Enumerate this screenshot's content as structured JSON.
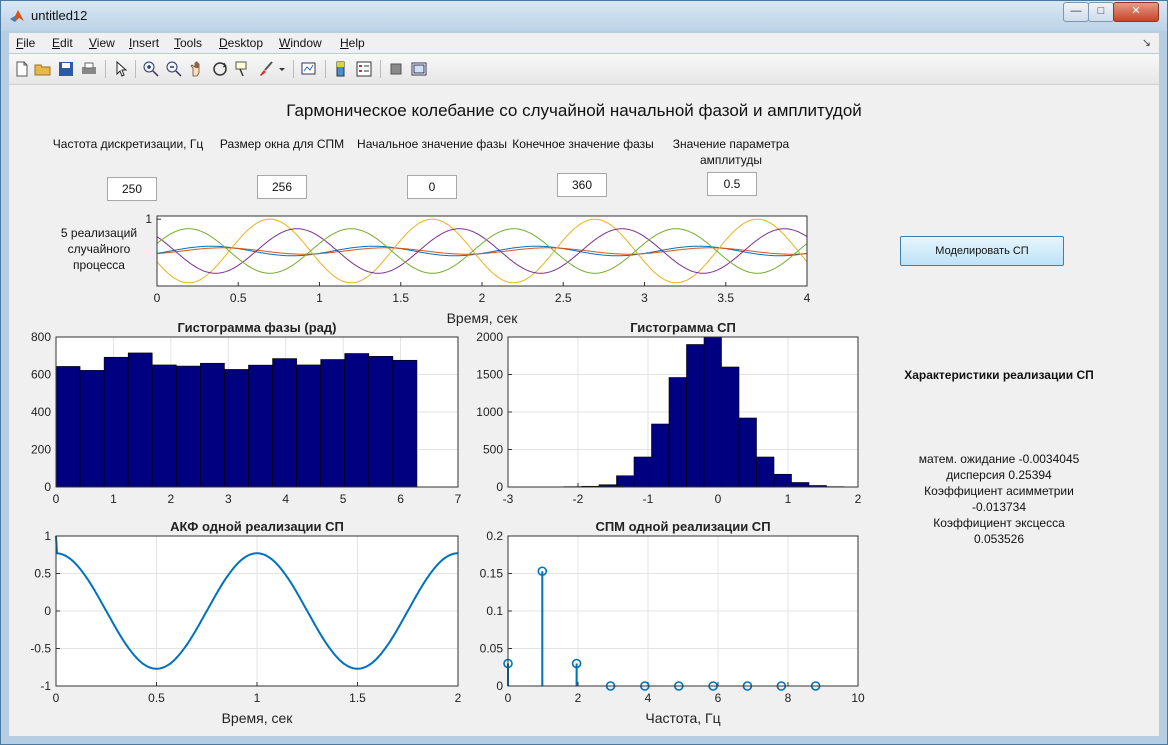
{
  "window": {
    "title": "untitled12",
    "controls": {
      "minimize": "—",
      "maximize": "□",
      "close": "✕"
    }
  },
  "menu": {
    "items": [
      {
        "label": "File",
        "key": "F"
      },
      {
        "label": "Edit",
        "key": "E"
      },
      {
        "label": "View",
        "key": "V"
      },
      {
        "label": "Insert",
        "key": "I"
      },
      {
        "label": "Tools",
        "key": "T"
      },
      {
        "label": "Desktop",
        "key": "D"
      },
      {
        "label": "Window",
        "key": "W"
      },
      {
        "label": "Help",
        "key": "H"
      }
    ],
    "overflow_arrow": "↘"
  },
  "toolbar": {
    "icons": [
      "new-figure-icon",
      "open-file-icon",
      "save-icon",
      "print-icon",
      "pointer-icon",
      "zoom-in-icon",
      "zoom-out-icon",
      "pan-icon",
      "rotate-3d-icon",
      "data-cursor-icon",
      "brush-icon",
      "link-plot-icon",
      "insert-colorbar-icon",
      "insert-legend-icon",
      "hide-plot-tools-icon",
      "show-plot-tools-icon"
    ]
  },
  "figure": {
    "title": "Гармоническое колебание со случайной начальной фазой и амплитудой",
    "params": [
      {
        "label": "Частота дискретизации, Гц",
        "value": "250"
      },
      {
        "label": "Размер окна для СПМ",
        "value": "256"
      },
      {
        "label": "Начальное значение фазы",
        "value": "0"
      },
      {
        "label": "Конечное значение фазы",
        "value": "360"
      },
      {
        "label": "Значение параметра амплитуды",
        "value": "0.5"
      }
    ],
    "process_label": "5 реализаций случайного процесса",
    "simulate_button": "Моделировать СП",
    "stats": {
      "title": "Характеристики реализации СП",
      "lines": [
        "матем. ожидание  -0.0034045",
        "дисперсия  0.25394",
        "Коэффициент асимметрии",
        "-0.013734",
        "Коэффициент эксцесса",
        "0.053526"
      ]
    }
  },
  "colors": {
    "bar_fill": "#000080",
    "line_blue": "#0072BD",
    "series": [
      "#0072BD",
      "#D95319",
      "#EDB120",
      "#7E2F8E",
      "#77AC30"
    ],
    "stem": "#0072BD"
  },
  "chart_data": [
    {
      "type": "line",
      "title": "",
      "xlabel": "Время, сек",
      "ylabel": "",
      "xlim": [
        0,
        4
      ],
      "ylim": [
        -1.1,
        1.1
      ],
      "xticks": [
        "0",
        "0.5",
        "1",
        "1.5",
        "2",
        "2.5",
        "3",
        "3.5",
        "4"
      ],
      "yticks": [
        "1"
      ],
      "grid": false,
      "frequency_hz": 1,
      "series": [
        {
          "amplitude": 0.15,
          "phase_deg": 330
        },
        {
          "amplitude": 0.1,
          "phase_deg": 305
        },
        {
          "amplitude": 1.0,
          "phase_deg": 200
        },
        {
          "amplitude": 0.7,
          "phase_deg": 140
        },
        {
          "amplitude": 0.7,
          "phase_deg": 20
        }
      ]
    },
    {
      "type": "bar",
      "title": "Гистограмма фазы (рад)",
      "xlabel": "",
      "ylabel": "",
      "xlim": [
        0,
        7
      ],
      "ylim": [
        0,
        800
      ],
      "xticks": [
        "0",
        "1",
        "2",
        "3",
        "4",
        "5",
        "6",
        "7"
      ],
      "yticks": [
        "0",
        "200",
        "400",
        "600",
        "800"
      ],
      "grid": true,
      "bin_start": 0,
      "bin_width": 0.419,
      "values": [
        643,
        622,
        692,
        715,
        651,
        645,
        660,
        627,
        650,
        685,
        651,
        680,
        712,
        697,
        676
      ]
    },
    {
      "type": "bar",
      "title": "Гистограмма СП",
      "xlabel": "",
      "ylabel": "",
      "xlim": [
        -3,
        2
      ],
      "ylim": [
        0,
        2000
      ],
      "xticks": [
        "-3",
        "-2",
        "-1",
        "0",
        "1",
        "2"
      ],
      "yticks": [
        "0",
        "500",
        "1000",
        "1500",
        "2000"
      ],
      "grid": true,
      "bin_start": -2.2,
      "bin_width": 0.25,
      "values": [
        5,
        10,
        30,
        150,
        400,
        840,
        1460,
        1900,
        2000,
        1600,
        920,
        400,
        170,
        60,
        20,
        5
      ]
    },
    {
      "type": "line",
      "title": "АКФ одной реализации СП",
      "xlabel": "Время, сек",
      "ylabel": "",
      "xlim": [
        0,
        2
      ],
      "ylim": [
        -1,
        1
      ],
      "xticks": [
        "0",
        "0.5",
        "1",
        "1.5",
        "2"
      ],
      "yticks": [
        "-1",
        "-0.5",
        "0",
        "0.5",
        "1"
      ],
      "grid": true,
      "x0_value": 1.0,
      "amplitude": 0.77,
      "frequency_hz": 1
    },
    {
      "type": "stem",
      "title": "СПМ одной реализации СП",
      "xlabel": "Частота, Гц",
      "ylabel": "",
      "xlim": [
        0,
        10
      ],
      "ylim": [
        0,
        0.2
      ],
      "xticks": [
        "0",
        "2",
        "4",
        "6",
        "8",
        "10"
      ],
      "yticks": [
        "0",
        "0.05",
        "0.1",
        "0.15",
        "0.2"
      ],
      "grid": true,
      "x": [
        0,
        0.98,
        1.96,
        2.93,
        3.91,
        4.88,
        5.86,
        6.84,
        7.81,
        8.79
      ],
      "values": [
        0.03,
        0.153,
        0.03,
        0,
        0,
        0,
        0,
        0,
        0,
        0
      ]
    }
  ]
}
